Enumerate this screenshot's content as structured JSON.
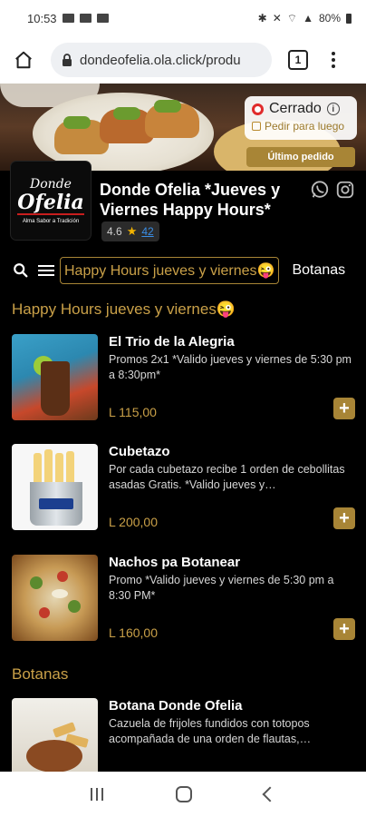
{
  "status_bar": {
    "time": "10:53",
    "battery": "80%"
  },
  "browser": {
    "url": "dondeofelia.ola.click/produ",
    "tab_count": "1"
  },
  "store_status": {
    "state": "Cerrado",
    "info": "i",
    "order_later": "Pedir para luego",
    "last_order": "Último pedido"
  },
  "restaurant": {
    "logo_top": "Donde",
    "logo_main": "Ofelia",
    "logo_sub": "Alma Sabor a Tradición",
    "name": "Donde Ofelia *Jueves y Viernes Happy Hours*",
    "rating": "4.6",
    "rating_count": "42"
  },
  "categories": {
    "active": "Happy Hours jueves y viernes😜",
    "next": "Botanas"
  },
  "sections": [
    {
      "title": "Happy Hours jueves y viernes😜",
      "items": [
        {
          "name": "El Trio de la Alegria",
          "desc": "Promos 2x1 *Valido jueves y viernes de 5:30 pm a 8:30pm*",
          "price": "L 115,00"
        },
        {
          "name": "Cubetazo",
          "desc": "Por cada cubetazo recibe 1 orden de cebollitas asadas Gratis. *Valido jueves y…",
          "price": "L 200,00"
        },
        {
          "name": "Nachos pa Botanear",
          "desc": "Promo *Valido jueves y viernes de 5:30 pm a 8:30 PM*",
          "price": "L 160,00"
        }
      ]
    },
    {
      "title": "Botanas",
      "items": [
        {
          "name": "Botana Donde Ofelia",
          "desc": "Cazuela de frijoles fundidos con totopos acompañada de una orden de flautas,…",
          "price": ""
        }
      ]
    }
  ],
  "add_label": "+"
}
